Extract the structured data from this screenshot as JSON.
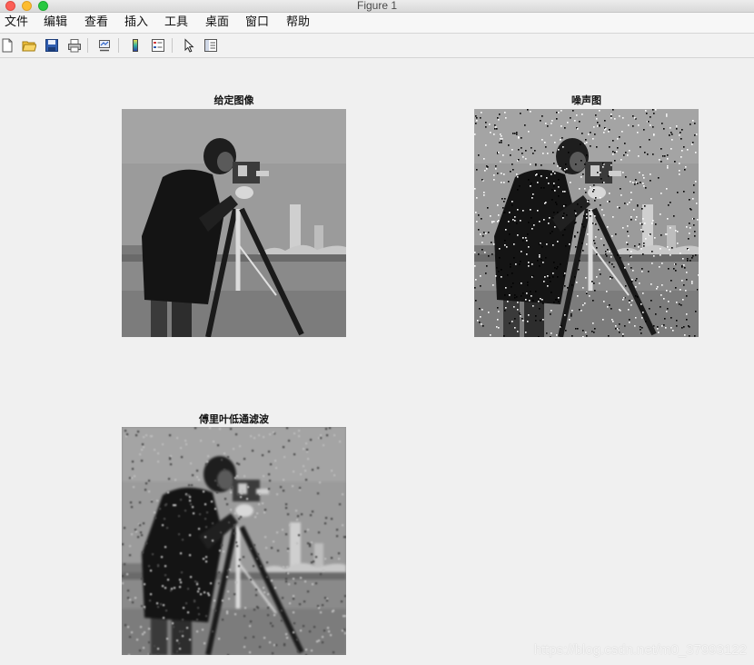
{
  "window": {
    "title": "Figure 1"
  },
  "menu": {
    "items": [
      "文件",
      "编辑",
      "查看",
      "插入",
      "工具",
      "桌面",
      "窗口",
      "帮助"
    ]
  },
  "toolbar": {
    "buttons": [
      {
        "name": "new-figure-icon"
      },
      {
        "name": "open-file-icon"
      },
      {
        "name": "save-icon"
      },
      {
        "name": "print-icon"
      },
      {
        "name": "link-plot-icon"
      },
      {
        "name": "colorbar-icon"
      },
      {
        "name": "legend-icon"
      },
      {
        "name": "pointer-icon"
      },
      {
        "name": "property-inspector-icon"
      }
    ]
  },
  "figure": {
    "subplots": [
      {
        "title": "给定图像",
        "variant": "original"
      },
      {
        "title": "噪声图",
        "variant": "noisy"
      },
      {
        "title": "傅里叶低通滤波",
        "variant": "filtered"
      }
    ]
  },
  "watermark": "https://blog.csdn.net/m0_37993122",
  "colors": {
    "background": "#f0f0f0",
    "close": "#fc5f57",
    "minimize": "#fdbc2e",
    "zoom": "#28c840"
  }
}
